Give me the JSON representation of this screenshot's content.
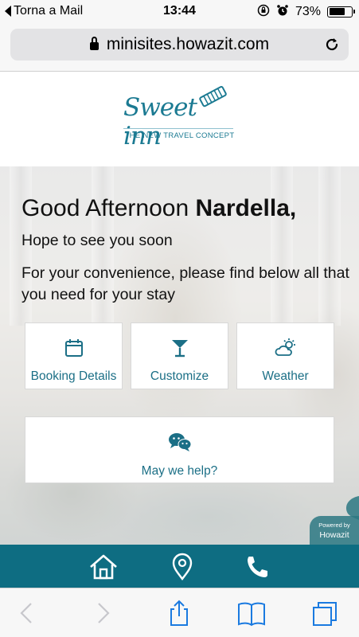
{
  "status_bar": {
    "back_label": "Torna a Mail",
    "time": "13:44",
    "battery_percent": "73%",
    "battery_level": 0.73,
    "icons": [
      "orientation-lock-icon",
      "alarm-icon",
      "battery-icon"
    ]
  },
  "browser": {
    "url": "minisites.howazit.com",
    "icons": [
      "lock-icon",
      "reload-icon"
    ]
  },
  "header": {
    "logo_text": "Sweet inn",
    "tagline": "THE NEW TRAVEL CONCEPT"
  },
  "hero": {
    "greeting_prefix": "Good Afternoon ",
    "guest_name": "Nardella,",
    "subtitle": "Hope to see you soon",
    "message": "For your convenience, please find below all that you need for your stay"
  },
  "cards": [
    {
      "label": "Booking Details",
      "icon": "calendar-icon"
    },
    {
      "label": "Customize",
      "icon": "cocktail-glass-icon"
    },
    {
      "label": "Weather",
      "icon": "partly-cloudy-icon"
    }
  ],
  "help_card": {
    "label": "May we help?",
    "icon": "chat-bubbles-icon"
  },
  "powered_badge": {
    "line1": "Powered by",
    "line2": "Howazit"
  },
  "site_nav": {
    "items": [
      {
        "name": "home",
        "icon": "home-icon"
      },
      {
        "name": "location",
        "icon": "location-pin-icon"
      },
      {
        "name": "call",
        "icon": "phone-icon"
      }
    ]
  },
  "safari_toolbar": {
    "items": [
      "back-icon",
      "forward-icon",
      "share-icon",
      "bookmarks-icon",
      "tabs-icon"
    ]
  },
  "colors": {
    "brand_teal": "#1b7a92",
    "nav_bar": "#0e6d82",
    "card_text": "#1b6f86"
  }
}
